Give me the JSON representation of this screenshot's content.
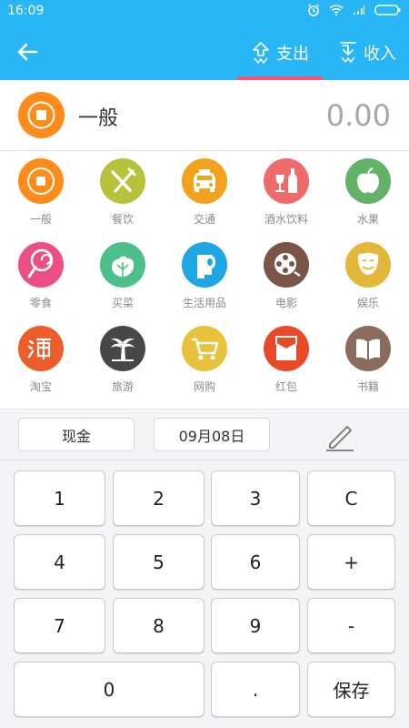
{
  "status_bar": {
    "time": "16:09"
  },
  "header": {
    "tabs": [
      {
        "label": "支出",
        "active": true
      },
      {
        "label": "收入",
        "active": false
      }
    ]
  },
  "summary": {
    "category": "一般",
    "amount": "0.00"
  },
  "categories": [
    {
      "label": "一般",
      "icon": "coin-icon",
      "color": "#ff8c1a"
    },
    {
      "label": "餐饮",
      "icon": "fork-knife-icon",
      "color": "#b6c23a"
    },
    {
      "label": "交通",
      "icon": "car-icon",
      "color": "#f2a21c"
    },
    {
      "label": "酒水饮料",
      "icon": "wine-bottle-icon",
      "color": "#ef6a6a"
    },
    {
      "label": "水果",
      "icon": "apple-icon",
      "color": "#63b26a"
    },
    {
      "label": "零食",
      "icon": "lollipop-icon",
      "color": "#ec4f84"
    },
    {
      "label": "买菜",
      "icon": "cabbage-icon",
      "color": "#4cbf8a"
    },
    {
      "label": "生活用品",
      "icon": "toilet-paper-icon",
      "color": "#1fa6e4"
    },
    {
      "label": "电影",
      "icon": "film-reel-icon",
      "color": "#7b5448"
    },
    {
      "label": "娱乐",
      "icon": "smiley-mask-icon",
      "color": "#e3b83a"
    },
    {
      "label": "淘宝",
      "icon": "taobao-icon",
      "color": "#ec5d2b"
    },
    {
      "label": "旅游",
      "icon": "palm-tree-icon",
      "color": "#474747"
    },
    {
      "label": "网购",
      "icon": "shopping-cart-icon",
      "color": "#e8c23b"
    },
    {
      "label": "红包",
      "icon": "red-envelope-icon",
      "color": "#e84a28"
    },
    {
      "label": "书籍",
      "icon": "book-icon",
      "color": "#8b6b5c"
    }
  ],
  "meta": {
    "account": "现金",
    "date": "09月08日"
  },
  "keypad": {
    "k1": "1",
    "k2": "2",
    "k3": "3",
    "clear": "C",
    "k4": "4",
    "k5": "5",
    "k6": "6",
    "plus": "+",
    "k7": "7",
    "k8": "8",
    "k9": "9",
    "minus": "-",
    "k0": "0",
    "dot": ".",
    "save": "保存"
  }
}
